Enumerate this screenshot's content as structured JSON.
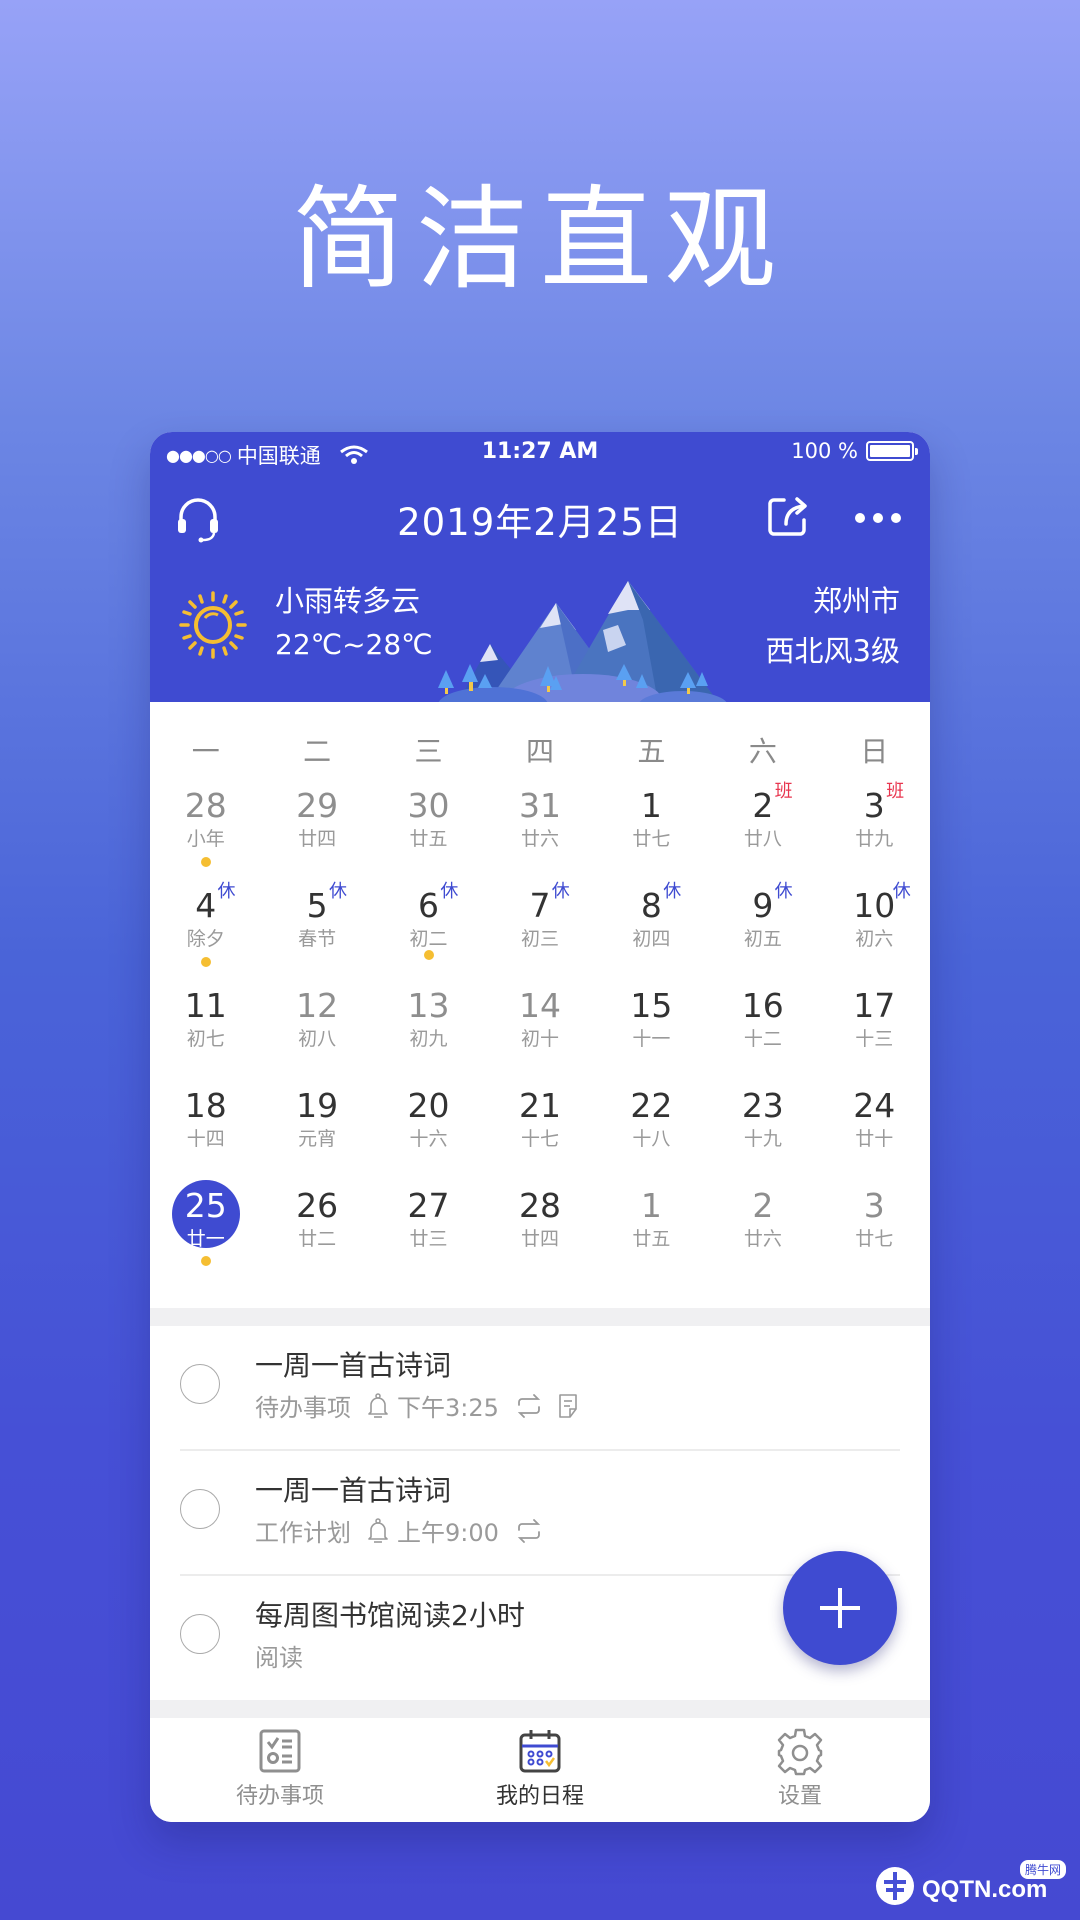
{
  "promo": {
    "headline": "简洁直观"
  },
  "status_bar": {
    "signal": "●●●○○",
    "carrier": "中国联通",
    "time": "11:27 AM",
    "battery": "100 %"
  },
  "header": {
    "title": "2019年2月25日"
  },
  "weather": {
    "condition": "小雨转多云",
    "temperature": "22℃~28℃",
    "city": "郑州市",
    "wind": "西北风3级"
  },
  "calendar": {
    "weekdays": [
      "一",
      "二",
      "三",
      "四",
      "五",
      "六",
      "日"
    ],
    "weeks": [
      [
        {
          "num": "28",
          "lunar": "小年",
          "other": true,
          "dot": true
        },
        {
          "num": "29",
          "lunar": "廿四",
          "other": true
        },
        {
          "num": "30",
          "lunar": "廿五",
          "other": true
        },
        {
          "num": "31",
          "lunar": "廿六",
          "other": true
        },
        {
          "num": "1",
          "lunar": "廿七"
        },
        {
          "num": "2",
          "lunar": "廿八",
          "tag": "班",
          "tagType": "work"
        },
        {
          "num": "3",
          "lunar": "廿九",
          "tag": "班",
          "tagType": "work"
        }
      ],
      [
        {
          "num": "4",
          "lunar": "除夕",
          "tag": "休",
          "tagType": "rest",
          "dot": true
        },
        {
          "num": "5",
          "lunar": "春节",
          "tag": "休",
          "tagType": "rest"
        },
        {
          "num": "6",
          "lunar": "初二",
          "tag": "休",
          "tagType": "rest",
          "dot": true
        },
        {
          "num": "7",
          "lunar": "初三",
          "tag": "休",
          "tagType": "rest"
        },
        {
          "num": "8",
          "lunar": "初四",
          "tag": "休",
          "tagType": "rest"
        },
        {
          "num": "9",
          "lunar": "初五",
          "tag": "休",
          "tagType": "rest"
        },
        {
          "num": "10",
          "lunar": "初六",
          "tag": "休",
          "tagType": "rest"
        }
      ],
      [
        {
          "num": "11",
          "lunar": "初七"
        },
        {
          "num": "12",
          "lunar": "初八",
          "other": true
        },
        {
          "num": "13",
          "lunar": "初九",
          "other": true
        },
        {
          "num": "14",
          "lunar": "初十",
          "other": true
        },
        {
          "num": "15",
          "lunar": "十一"
        },
        {
          "num": "16",
          "lunar": "十二"
        },
        {
          "num": "17",
          "lunar": "十三"
        }
      ],
      [
        {
          "num": "18",
          "lunar": "十四"
        },
        {
          "num": "19",
          "lunar": "元宵"
        },
        {
          "num": "20",
          "lunar": "十六"
        },
        {
          "num": "21",
          "lunar": "十七"
        },
        {
          "num": "22",
          "lunar": "十八"
        },
        {
          "num": "23",
          "lunar": "十九"
        },
        {
          "num": "24",
          "lunar": "廿十"
        }
      ],
      [
        {
          "num": "25",
          "lunar": "廿一",
          "today": true,
          "dot": true
        },
        {
          "num": "26",
          "lunar": "廿二"
        },
        {
          "num": "27",
          "lunar": "廿三"
        },
        {
          "num": "28",
          "lunar": "廿四"
        },
        {
          "num": "1",
          "lunar": "廿五",
          "other": true
        },
        {
          "num": "2",
          "lunar": "廿六",
          "other": true
        },
        {
          "num": "3",
          "lunar": "廿七",
          "other": true
        }
      ]
    ]
  },
  "tasks": [
    {
      "title": "一周一首古诗词",
      "category": "待办事项",
      "reminder": "下午3:25",
      "repeat": true,
      "note": true
    },
    {
      "title": "一周一首古诗词",
      "category": "工作计划",
      "reminder": "上午9:00",
      "repeat": true,
      "note": false
    },
    {
      "title": "每周图书馆阅读2小时",
      "category": "阅读",
      "reminder": null,
      "repeat": false,
      "note": false
    }
  ],
  "tabs": [
    {
      "label": "待办事项",
      "icon": "checklist-icon",
      "active": false
    },
    {
      "label": "我的日程",
      "icon": "calendar-icon",
      "active": true
    },
    {
      "label": "设置",
      "icon": "gear-icon",
      "active": false
    }
  ],
  "colors": {
    "primary": "#3f4bd1",
    "dot": "#f5be32",
    "work_tag": "#e8364f"
  },
  "watermark": {
    "brand": "QQTN.com",
    "label": "腾牛网"
  }
}
